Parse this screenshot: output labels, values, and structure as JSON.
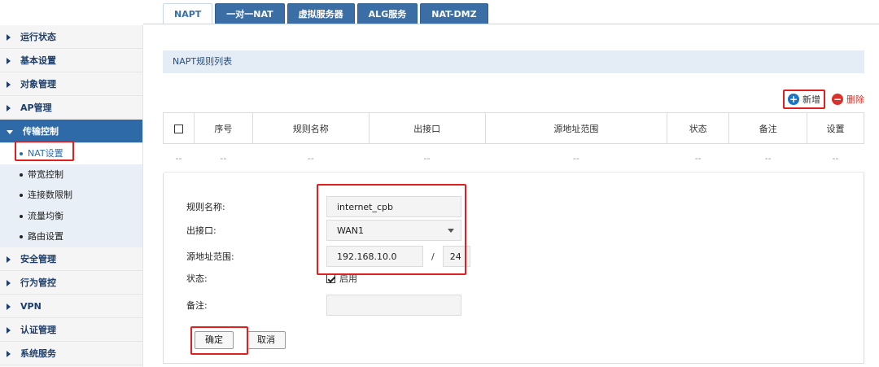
{
  "tabs": [
    "NAPT",
    "一对一NAT",
    "虚拟服务器",
    "ALG服务",
    "NAT-DMZ"
  ],
  "sidebar": {
    "top_items": [
      "运行状态",
      "基本设置",
      "对象管理",
      "AP管理"
    ],
    "active_item": "传输控制",
    "sub_items": [
      "NAT设置",
      "带宽控制",
      "连接数限制",
      "流量均衡",
      "路由设置"
    ],
    "bottom_items": [
      "安全管理",
      "行为管控",
      "VPN",
      "认证管理",
      "系统服务"
    ]
  },
  "section_title": "NAPT规则列表",
  "actions": {
    "add": "新增",
    "delete": "删除"
  },
  "table": {
    "headers": [
      "序号",
      "规则名称",
      "出接口",
      "源地址范围",
      "状态",
      "备注",
      "设置"
    ],
    "row": [
      "--",
      "--",
      "--",
      "--",
      "--",
      "--",
      "--",
      "--"
    ]
  },
  "form": {
    "name_label": "规则名称:",
    "name_value": "internet_cpb",
    "iface_label": "出接口:",
    "iface_value": "WAN1",
    "src_label": "源地址范围:",
    "src_ip": "192.168.10.0",
    "src_sep": "/",
    "src_mask": "24",
    "status_label": "状态:",
    "status_enable": "启用",
    "remark_label": "备注:",
    "remark_value": "",
    "ok": "确定",
    "cancel": "取消"
  },
  "colors": {
    "accent": "#2e6aa8",
    "highlight": "#e02020",
    "tab": "#3a6ea5"
  }
}
